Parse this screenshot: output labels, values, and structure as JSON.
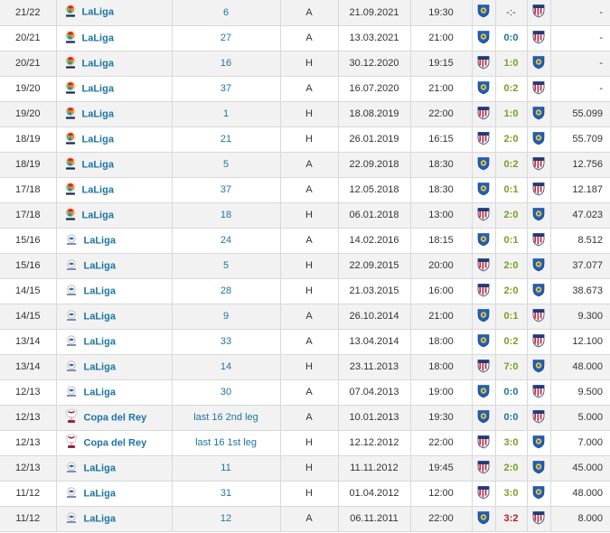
{
  "matches": [
    {
      "season": "21/22",
      "competition": "LaLiga",
      "logo": "laliga-new",
      "round": "6",
      "venue": "A",
      "date": "21.09.2021",
      "time": "19:30",
      "home": "getafe",
      "away": "atletico",
      "result": "-:-",
      "result_class": "na",
      "attendance": "-"
    },
    {
      "season": "20/21",
      "competition": "LaLiga",
      "logo": "laliga-new",
      "round": "27",
      "venue": "A",
      "date": "13.03.2021",
      "time": "21:00",
      "home": "getafe",
      "away": "atletico",
      "result": "0:0",
      "result_class": "draw",
      "attendance": "-"
    },
    {
      "season": "20/21",
      "competition": "LaLiga",
      "logo": "laliga-new",
      "round": "16",
      "venue": "H",
      "date": "30.12.2020",
      "time": "19:15",
      "home": "atletico",
      "away": "getafe",
      "result": "1:0",
      "result_class": "win",
      "attendance": "-"
    },
    {
      "season": "19/20",
      "competition": "LaLiga",
      "logo": "laliga-new",
      "round": "37",
      "venue": "A",
      "date": "16.07.2020",
      "time": "21:00",
      "home": "getafe",
      "away": "atletico",
      "result": "0:2",
      "result_class": "win",
      "attendance": "-"
    },
    {
      "season": "19/20",
      "competition": "LaLiga",
      "logo": "laliga-new",
      "round": "1",
      "venue": "H",
      "date": "18.08.2019",
      "time": "22:00",
      "home": "atletico",
      "away": "getafe",
      "result": "1:0",
      "result_class": "win",
      "attendance": "55.099"
    },
    {
      "season": "18/19",
      "competition": "LaLiga",
      "logo": "laliga-new",
      "round": "21",
      "venue": "H",
      "date": "26.01.2019",
      "time": "16:15",
      "home": "atletico",
      "away": "getafe",
      "result": "2:0",
      "result_class": "win",
      "attendance": "55.709"
    },
    {
      "season": "18/19",
      "competition": "LaLiga",
      "logo": "laliga-new",
      "round": "5",
      "venue": "A",
      "date": "22.09.2018",
      "time": "18:30",
      "home": "getafe",
      "away": "atletico",
      "result": "0:2",
      "result_class": "win",
      "attendance": "12.756"
    },
    {
      "season": "17/18",
      "competition": "LaLiga",
      "logo": "laliga-new",
      "round": "37",
      "venue": "A",
      "date": "12.05.2018",
      "time": "18:30",
      "home": "getafe",
      "away": "atletico",
      "result": "0:1",
      "result_class": "win",
      "attendance": "12.187"
    },
    {
      "season": "17/18",
      "competition": "LaLiga",
      "logo": "laliga-new",
      "round": "18",
      "venue": "H",
      "date": "06.01.2018",
      "time": "13:00",
      "home": "atletico",
      "away": "getafe",
      "result": "2:0",
      "result_class": "win",
      "attendance": "47.023"
    },
    {
      "season": "15/16",
      "competition": "LaLiga",
      "logo": "laliga-old",
      "round": "24",
      "venue": "A",
      "date": "14.02.2016",
      "time": "18:15",
      "home": "getafe",
      "away": "atletico",
      "result": "0:1",
      "result_class": "win",
      "attendance": "8.512"
    },
    {
      "season": "15/16",
      "competition": "LaLiga",
      "logo": "laliga-old",
      "round": "5",
      "venue": "H",
      "date": "22.09.2015",
      "time": "20:00",
      "home": "atletico",
      "away": "getafe",
      "result": "2:0",
      "result_class": "win",
      "attendance": "37.077"
    },
    {
      "season": "14/15",
      "competition": "LaLiga",
      "logo": "laliga-old",
      "round": "28",
      "venue": "H",
      "date": "21.03.2015",
      "time": "16:00",
      "home": "atletico",
      "away": "getafe",
      "result": "2:0",
      "result_class": "win",
      "attendance": "38.673"
    },
    {
      "season": "14/15",
      "competition": "LaLiga",
      "logo": "laliga-old",
      "round": "9",
      "venue": "A",
      "date": "26.10.2014",
      "time": "21:00",
      "home": "getafe",
      "away": "atletico",
      "result": "0:1",
      "result_class": "win",
      "attendance": "9.300"
    },
    {
      "season": "13/14",
      "competition": "LaLiga",
      "logo": "laliga-old",
      "round": "33",
      "venue": "A",
      "date": "13.04.2014",
      "time": "18:00",
      "home": "getafe",
      "away": "atletico",
      "result": "0:2",
      "result_class": "win",
      "attendance": "12.100"
    },
    {
      "season": "13/14",
      "competition": "LaLiga",
      "logo": "laliga-old",
      "round": "14",
      "venue": "H",
      "date": "23.11.2013",
      "time": "18:00",
      "home": "atletico",
      "away": "getafe",
      "result": "7:0",
      "result_class": "win",
      "attendance": "48.000"
    },
    {
      "season": "12/13",
      "competition": "LaLiga",
      "logo": "laliga-old",
      "round": "30",
      "venue": "A",
      "date": "07.04.2013",
      "time": "19:00",
      "home": "getafe",
      "away": "atletico",
      "result": "0:0",
      "result_class": "draw",
      "attendance": "9.500"
    },
    {
      "season": "12/13",
      "competition": "Copa del Rey",
      "logo": "copa",
      "round": "last 16 2nd leg",
      "venue": "A",
      "date": "10.01.2013",
      "time": "19:30",
      "home": "getafe",
      "away": "atletico",
      "result": "0:0",
      "result_class": "draw",
      "attendance": "5.000"
    },
    {
      "season": "12/13",
      "competition": "Copa del Rey",
      "logo": "copa",
      "round": "last 16 1st leg",
      "venue": "H",
      "date": "12.12.2012",
      "time": "22:00",
      "home": "atletico",
      "away": "getafe",
      "result": "3:0",
      "result_class": "win",
      "attendance": "7.000"
    },
    {
      "season": "12/13",
      "competition": "LaLiga",
      "logo": "laliga-old",
      "round": "11",
      "venue": "H",
      "date": "11.11.2012",
      "time": "19:45",
      "home": "atletico",
      "away": "getafe",
      "result": "2:0",
      "result_class": "win",
      "attendance": "45.000"
    },
    {
      "season": "11/12",
      "competition": "LaLiga",
      "logo": "laliga-old",
      "round": "31",
      "venue": "H",
      "date": "01.04.2012",
      "time": "12:00",
      "home": "atletico",
      "away": "getafe",
      "result": "3:0",
      "result_class": "win",
      "attendance": "48.000"
    },
    {
      "season": "11/12",
      "competition": "LaLiga",
      "logo": "laliga-old",
      "round": "12",
      "venue": "A",
      "date": "06.11.2011",
      "time": "22:00",
      "home": "getafe",
      "away": "atletico",
      "result": "3:2",
      "result_class": "loss",
      "attendance": "8.000"
    }
  ],
  "colors": {
    "link": "#1d75a3",
    "win": "#75a122",
    "draw": "#1d75a3",
    "loss": "#b81c1c",
    "row_alt": "#f2f2f2",
    "border": "#d9d9d9"
  },
  "icons": {
    "laliga-new": "laliga-logo-icon",
    "laliga-old": "laliga-old-logo-icon",
    "copa": "copa-del-rey-logo-icon",
    "getafe": "getafe-crest-icon",
    "atletico": "atletico-madrid-crest-icon"
  }
}
